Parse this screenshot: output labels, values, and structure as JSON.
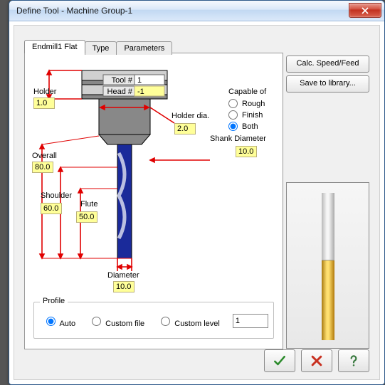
{
  "window": {
    "title": "Define Tool - Machine Group-1"
  },
  "tabs": {
    "t0": "Endmill1 Flat",
    "t1": "Type",
    "t2": "Parameters"
  },
  "buttons": {
    "calc": "Calc. Speed/Feed",
    "save": "Save to library..."
  },
  "capable": {
    "label": "Capable of",
    "rough": "Rough",
    "finish": "Finish",
    "both": "Both"
  },
  "diagram": {
    "tool_no_label": "Tool #",
    "tool_no": "1",
    "head_no_label": "Head #",
    "head_no": "-1",
    "holder_label": "Holder",
    "holder": "1.0",
    "holder_dia_label": "Holder dia.",
    "holder_dia": "2.0",
    "shank_label": "Shank Diameter",
    "shank": "10.0",
    "overall_label": "Overall",
    "overall": "80.0",
    "shoulder_label": "Shoulder",
    "shoulder": "60.0",
    "flute_label": "Flute",
    "flute": "50.0",
    "diameter_label": "Diameter",
    "diameter": "10.0"
  },
  "profile": {
    "legend": "Profile",
    "auto": "Auto",
    "file": "Custom file",
    "level": "Custom level",
    "level_value": "1"
  }
}
